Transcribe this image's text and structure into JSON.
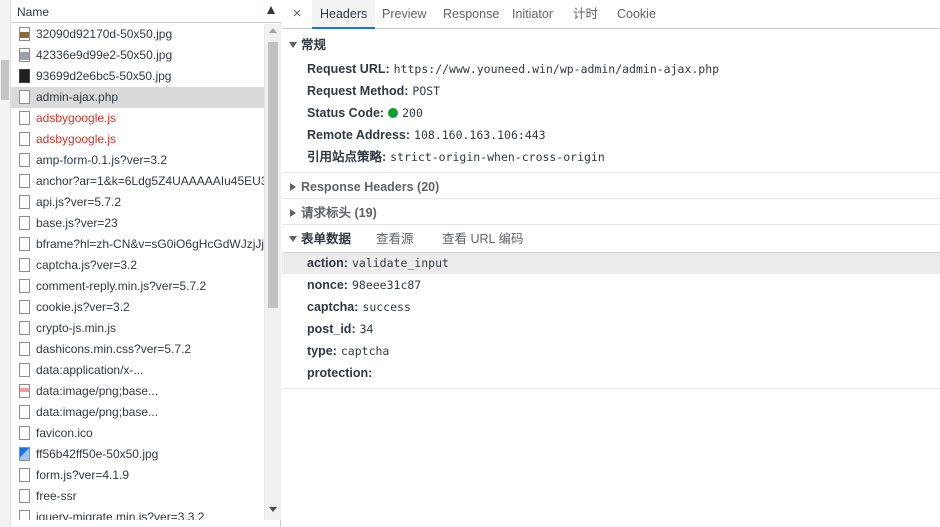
{
  "list": {
    "header": "Name",
    "rows": [
      {
        "name": "32090d92170d-50x50.jpg",
        "icon": "image-icon",
        "status": "ok"
      },
      {
        "name": "42336e9d99e2-50x50.jpg",
        "icon": "image-icon",
        "status": "ok"
      },
      {
        "name": "93699d2e6bc5-50x50.jpg",
        "icon": "image-icon",
        "status": "ok"
      },
      {
        "name": "admin-ajax.php",
        "icon": "document-icon",
        "status": "selected"
      },
      {
        "name": "adsbygoogle.js",
        "icon": "document-icon",
        "status": "error"
      },
      {
        "name": "adsbygoogle.js",
        "icon": "document-icon",
        "status": "error"
      },
      {
        "name": "amp-form-0.1.js?ver=3.2",
        "icon": "document-icon",
        "status": "ok"
      },
      {
        "name": "anchor?ar=1&k=6Ldg5Z4UAAAAAIu45EU3",
        "icon": "document-icon",
        "status": "ok"
      },
      {
        "name": "api.js?ver=5.7.2",
        "icon": "document-icon",
        "status": "ok"
      },
      {
        "name": "base.js?ver=23",
        "icon": "document-icon",
        "status": "ok"
      },
      {
        "name": "bframe?hl=zh-CN&v=sG0iO6gHcGdWJzjJj.",
        "icon": "document-icon",
        "status": "ok"
      },
      {
        "name": "captcha.js?ver=3.2",
        "icon": "document-icon",
        "status": "ok"
      },
      {
        "name": "comment-reply.min.js?ver=5.7.2",
        "icon": "document-icon",
        "status": "ok"
      },
      {
        "name": "cookie.js?ver=3.2",
        "icon": "document-icon",
        "status": "ok"
      },
      {
        "name": "crypto-js.min.js",
        "icon": "document-icon",
        "status": "ok"
      },
      {
        "name": "dashicons.min.css?ver=5.7.2",
        "icon": "document-icon",
        "status": "ok"
      },
      {
        "name": "data:application/x-...",
        "icon": "document-icon",
        "status": "ok"
      },
      {
        "name": "data:image/png;base...",
        "icon": "image-icon",
        "status": "ok"
      },
      {
        "name": "data:image/png;base...",
        "icon": "document-icon",
        "status": "ok"
      },
      {
        "name": "favicon.ico",
        "icon": "document-icon",
        "status": "ok"
      },
      {
        "name": "ff56b42ff50e-50x50.jpg",
        "icon": "image-icon",
        "status": "ok"
      },
      {
        "name": "form.js?ver=4.1.9",
        "icon": "document-icon",
        "status": "ok"
      },
      {
        "name": "free-ssr",
        "icon": "document-icon",
        "status": "ok"
      },
      {
        "name": "jquery-migrate.min.js?ver=3.3.2",
        "icon": "document-icon",
        "status": "ok"
      }
    ]
  },
  "tabs": {
    "close": "×",
    "items": [
      "Headers",
      "Preview",
      "Response",
      "Initiator",
      "计时",
      "Cookie"
    ],
    "active": "Headers"
  },
  "general": {
    "title": "常规",
    "request_url_label": "Request URL:",
    "request_url": "https://www.youneed.win/wp-admin/admin-ajax.php",
    "method_label": "Request Method:",
    "method": "POST",
    "status_label": "Status Code:",
    "status": "200",
    "status_color": "#0a9e2f",
    "remote_label": "Remote Address:",
    "remote": "108.160.163.106:443",
    "referrer_label": "引用站点策略:",
    "referrer": "strict-origin-when-cross-origin"
  },
  "response_headers": {
    "title": "Response Headers",
    "count": "(20)"
  },
  "request_headers": {
    "title": "请求标头",
    "count": "(19)"
  },
  "form_data": {
    "title": "表单数据",
    "view_source": "查看源",
    "view_url_encoded": "查看 URL 编码",
    "fields": [
      {
        "key": "action:",
        "value": "validate_input"
      },
      {
        "key": "nonce:",
        "value": "98eee31c87"
      },
      {
        "key": "captcha:",
        "value": "success"
      },
      {
        "key": "post_id:",
        "value": "34"
      },
      {
        "key": "type:",
        "value": "captcha"
      },
      {
        "key": "protection:",
        "value": ""
      }
    ]
  },
  "accent": "#1a73e8",
  "error_color": "#d93025"
}
